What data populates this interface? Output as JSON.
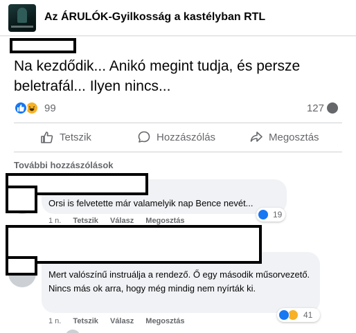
{
  "group": {
    "name": "Az ÁRULÓK-Gyilkosság a kastélyban RTL"
  },
  "post": {
    "text": "Na kezdődik... Anikó megint tudja, és persze beletrafál... Ilyen nincs...",
    "reaction_count": "99",
    "reaction_icons": [
      "like-icon",
      "haha-icon"
    ],
    "comment_count": "127"
  },
  "actions": {
    "like": "Tetszik",
    "comment": "Hozzászólás",
    "share": "Megosztás"
  },
  "more_comments_label": "További hozzászólások",
  "comments": [
    {
      "text": "Orsi is felvetette már valamelyik nap Bence nevét...",
      "time": "1 n.",
      "like_label": "Tetszik",
      "reply_label": "Válasz",
      "share_label": "Megosztás",
      "reaction_count": "19",
      "reaction_icons": [
        "like-icon"
      ]
    },
    {
      "text": "Mert valószínű instruálja a rendező. Ő egy második műsorvezető. Nincs más ok arra, hogy még mindig nem nyírták ki.",
      "time": "1 n.",
      "like_label": "Tetszik",
      "reply_label": "Válasz",
      "share_label": "Megosztás",
      "reaction_count": "41",
      "reaction_icons": [
        "like-icon",
        "haha-icon"
      ]
    }
  ],
  "colors": {
    "like_blue": "#1877f2",
    "haha_yellow": "#f7b125",
    "secondary_text": "#65676b"
  }
}
